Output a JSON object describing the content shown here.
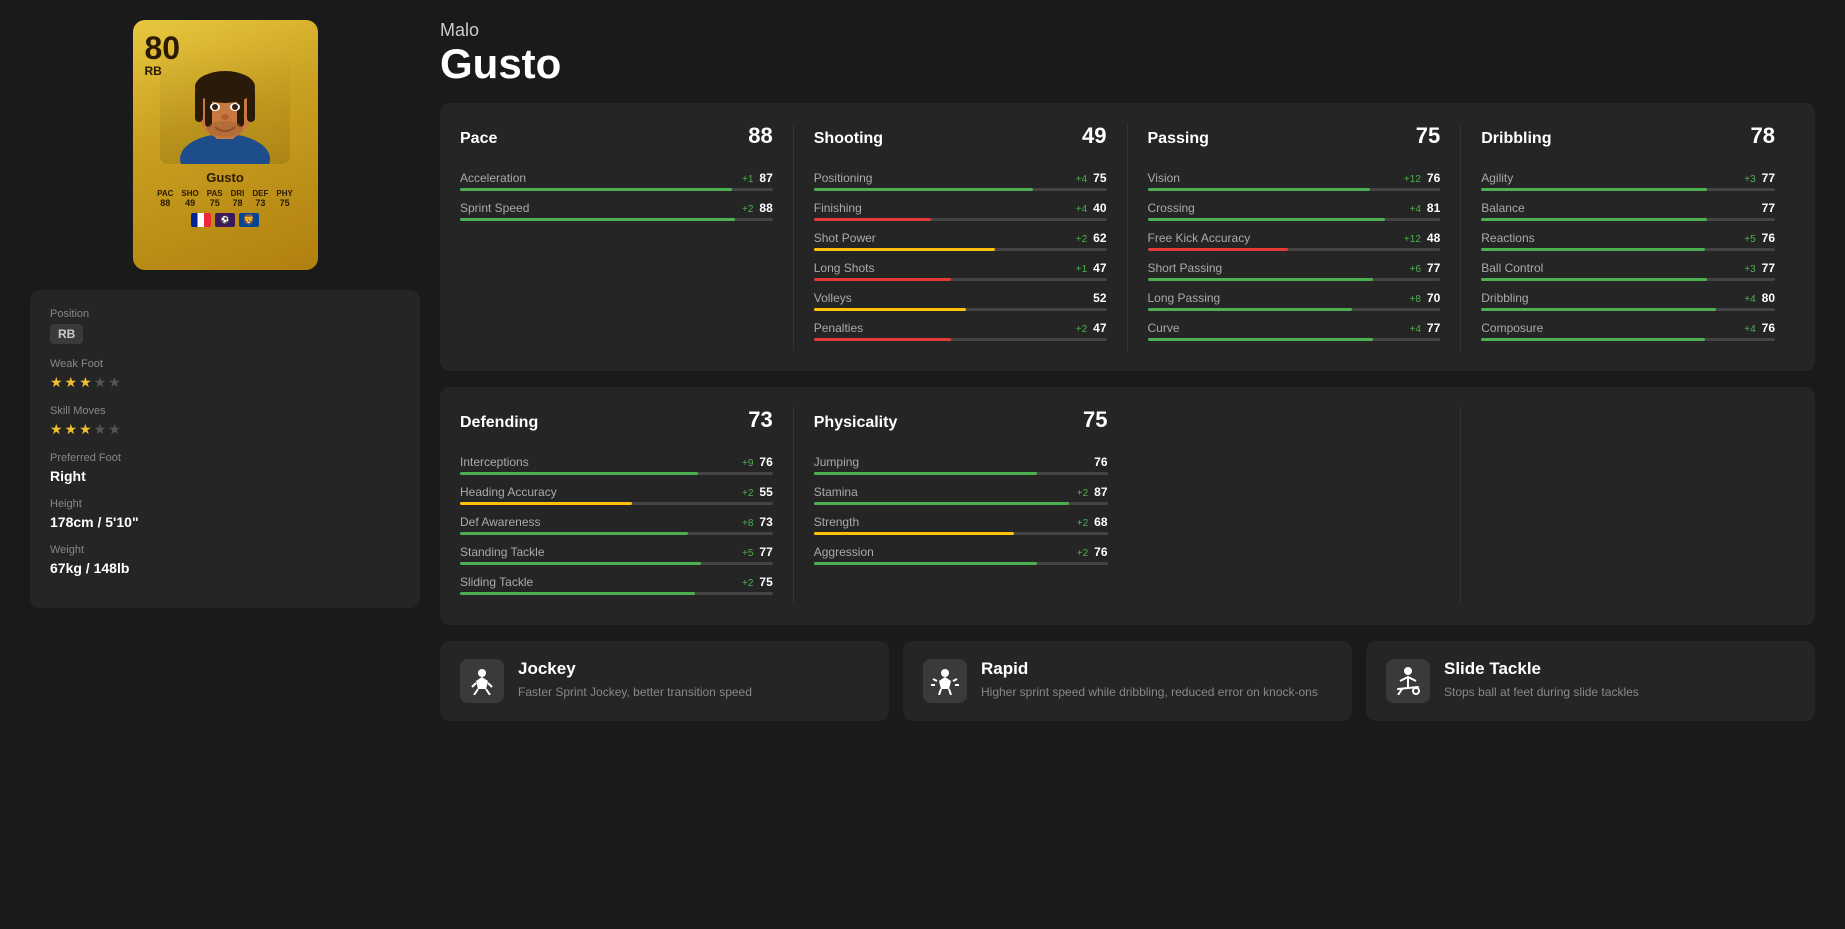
{
  "player": {
    "first_name": "Malo",
    "last_name": "Gusto",
    "overall": "80",
    "position": "RB",
    "card_name": "Gusto",
    "stats_summary": {
      "pac": "88",
      "sho": "49",
      "pas": "75",
      "dri": "78",
      "def": "73",
      "phy": "75"
    }
  },
  "info": {
    "position_label": "Position",
    "position_value": "RB",
    "weak_foot_label": "Weak Foot",
    "weak_foot_stars": 3,
    "skill_moves_label": "Skill Moves",
    "skill_moves_stars": 3,
    "preferred_foot_label": "Preferred Foot",
    "preferred_foot_value": "Right",
    "height_label": "Height",
    "height_value": "178cm / 5'10\"",
    "weight_label": "Weight",
    "weight_value": "67kg / 148lb"
  },
  "categories": [
    {
      "name": "Pace",
      "value": "88",
      "attributes": [
        {
          "name": "Acceleration",
          "modifier": "+1",
          "modifier_type": "positive",
          "value": 87,
          "bar_color": "green"
        },
        {
          "name": "Sprint Speed",
          "modifier": "+2",
          "modifier_type": "positive",
          "value": 88,
          "bar_color": "green"
        }
      ]
    },
    {
      "name": "Shooting",
      "value": "49",
      "attributes": [
        {
          "name": "Positioning",
          "modifier": "+4",
          "modifier_type": "positive",
          "value": 75,
          "bar_color": "green"
        },
        {
          "name": "Finishing",
          "modifier": "+4",
          "modifier_type": "positive",
          "value": 40,
          "bar_color": "red"
        },
        {
          "name": "Shot Power",
          "modifier": "+2",
          "modifier_type": "positive",
          "value": 62,
          "bar_color": "yellow"
        },
        {
          "name": "Long Shots",
          "modifier": "+1",
          "modifier_type": "positive",
          "value": 47,
          "bar_color": "red"
        },
        {
          "name": "Volleys",
          "modifier": "",
          "modifier_type": "",
          "value": 52,
          "bar_color": "yellow"
        },
        {
          "name": "Penalties",
          "modifier": "+2",
          "modifier_type": "positive",
          "value": 47,
          "bar_color": "red"
        }
      ]
    },
    {
      "name": "Passing",
      "value": "75",
      "attributes": [
        {
          "name": "Vision",
          "modifier": "+12",
          "modifier_type": "positive",
          "value": 76,
          "bar_color": "green"
        },
        {
          "name": "Crossing",
          "modifier": "+4",
          "modifier_type": "positive",
          "value": 81,
          "bar_color": "green"
        },
        {
          "name": "Free Kick Accuracy",
          "modifier": "+12",
          "modifier_type": "positive",
          "value": 48,
          "bar_color": "red"
        },
        {
          "name": "Short Passing",
          "modifier": "+6",
          "modifier_type": "positive",
          "value": 77,
          "bar_color": "green"
        },
        {
          "name": "Long Passing",
          "modifier": "+8",
          "modifier_type": "positive",
          "value": 70,
          "bar_color": "green"
        },
        {
          "name": "Curve",
          "modifier": "+4",
          "modifier_type": "positive",
          "value": 77,
          "bar_color": "green"
        }
      ]
    },
    {
      "name": "Dribbling",
      "value": "78",
      "attributes": [
        {
          "name": "Agility",
          "modifier": "+3",
          "modifier_type": "positive",
          "value": 77,
          "bar_color": "green"
        },
        {
          "name": "Balance",
          "modifier": "",
          "modifier_type": "",
          "value": 77,
          "bar_color": "green"
        },
        {
          "name": "Reactions",
          "modifier": "+5",
          "modifier_type": "positive",
          "value": 76,
          "bar_color": "green"
        },
        {
          "name": "Ball Control",
          "modifier": "+3",
          "modifier_type": "positive",
          "value": 77,
          "bar_color": "green"
        },
        {
          "name": "Dribbling",
          "modifier": "+4",
          "modifier_type": "positive",
          "value": 80,
          "bar_color": "green"
        },
        {
          "name": "Composure",
          "modifier": "+4",
          "modifier_type": "positive",
          "value": 76,
          "bar_color": "green"
        }
      ]
    }
  ],
  "lower_categories": [
    {
      "name": "Defending",
      "value": "73",
      "attributes": [
        {
          "name": "Interceptions",
          "modifier": "+9",
          "modifier_type": "positive",
          "value": 76,
          "bar_color": "green"
        },
        {
          "name": "Heading Accuracy",
          "modifier": "+2",
          "modifier_type": "positive",
          "value": 55,
          "bar_color": "yellow"
        },
        {
          "name": "Def Awareness",
          "modifier": "+8",
          "modifier_type": "positive",
          "value": 73,
          "bar_color": "green"
        },
        {
          "name": "Standing Tackle",
          "modifier": "+5",
          "modifier_type": "positive",
          "value": 77,
          "bar_color": "green"
        },
        {
          "name": "Sliding Tackle",
          "modifier": "+2",
          "modifier_type": "positive",
          "value": 75,
          "bar_color": "green"
        }
      ]
    },
    {
      "name": "Physicality",
      "value": "75",
      "attributes": [
        {
          "name": "Jumping",
          "modifier": "",
          "modifier_type": "",
          "value": 76,
          "bar_color": "green"
        },
        {
          "name": "Stamina",
          "modifier": "+2",
          "modifier_type": "positive",
          "value": 87,
          "bar_color": "green"
        },
        {
          "name": "Strength",
          "modifier": "+2",
          "modifier_type": "positive",
          "value": 68,
          "bar_color": "yellow"
        },
        {
          "name": "Aggression",
          "modifier": "+2",
          "modifier_type": "positive",
          "value": 76,
          "bar_color": "green"
        }
      ]
    }
  ],
  "playstyles": [
    {
      "name": "Jockey",
      "description": "Faster Sprint Jockey, better transition speed",
      "icon": "jockey"
    },
    {
      "name": "Rapid",
      "description": "Higher sprint speed while dribbling, reduced error on knock-ons",
      "icon": "rapid"
    },
    {
      "name": "Slide Tackle",
      "description": "Stops ball at feet during slide tackles",
      "icon": "slide-tackle"
    }
  ]
}
